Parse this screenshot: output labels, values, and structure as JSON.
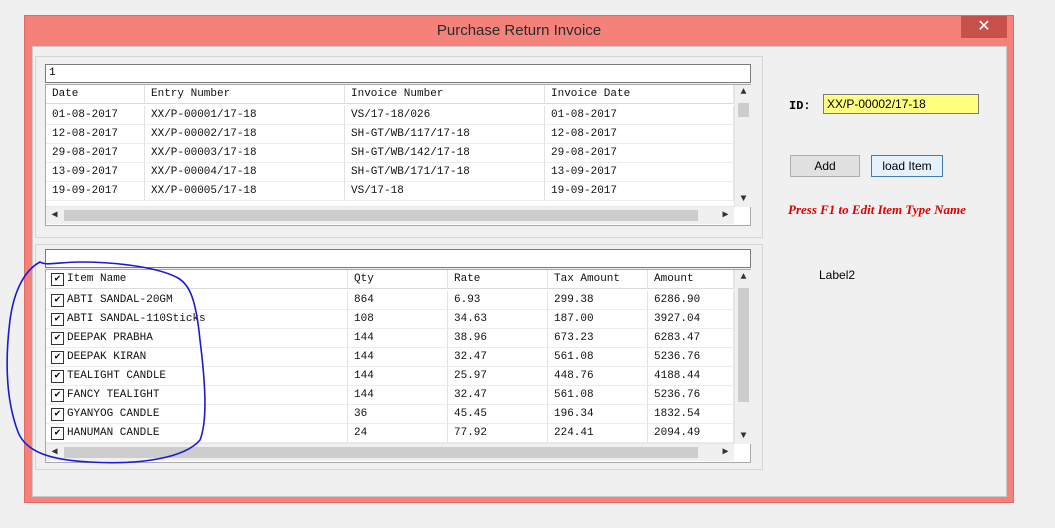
{
  "window": {
    "title": "Purchase Return Invoice",
    "close_glyph": "✕"
  },
  "top_grid": {
    "filter_value": "1",
    "columns": [
      "Date",
      "Entry Number",
      "Invoice Number",
      "Invoice Date"
    ],
    "rows": [
      [
        "01-08-2017",
        "XX/P-00001/17-18",
        "VS/17-18/026",
        "01-08-2017"
      ],
      [
        "12-08-2017",
        "XX/P-00002/17-18",
        "SH-GT/WB/117/17-18",
        "12-08-2017"
      ],
      [
        "29-08-2017",
        "XX/P-00003/17-18",
        "SH-GT/WB/142/17-18",
        "29-08-2017"
      ],
      [
        "13-09-2017",
        "XX/P-00004/17-18",
        "SH-GT/WB/171/17-18",
        "13-09-2017"
      ],
      [
        "19-09-2017",
        "XX/P-00005/17-18",
        "VS/17-18",
        "19-09-2017"
      ]
    ]
  },
  "bottom_grid": {
    "filter_value": "",
    "columns": [
      "Item Name",
      "Qty",
      "Rate",
      "Tax Amount",
      "Amount"
    ],
    "rows": [
      [
        "ABTI SANDAL-20GM",
        "864",
        "6.93",
        "299.38",
        "6286.90"
      ],
      [
        "ABTI SANDAL-110Sticks",
        "108",
        "34.63",
        "187.00",
        "3927.04"
      ],
      [
        "DEEPAK PRABHA",
        "144",
        "38.96",
        "673.23",
        "6283.47"
      ],
      [
        "DEEPAK KIRAN",
        "144",
        "32.47",
        "561.08",
        "5236.76"
      ],
      [
        "TEALIGHT CANDLE",
        "144",
        "25.97",
        "448.76",
        "4188.44"
      ],
      [
        "FANCY TEALIGHT",
        "144",
        "32.47",
        "561.08",
        "5236.76"
      ],
      [
        "GYANYOG CANDLE",
        "36",
        "45.45",
        "196.34",
        "1832.54"
      ],
      [
        "HANUMAN CANDLE",
        "24",
        "77.92",
        "224.41",
        "2094.49"
      ]
    ]
  },
  "side": {
    "id_label": "ID:",
    "id_value": "XX/P-00002/17-18",
    "add_label": "Add",
    "load_label": "load Item",
    "hint": "Press F1 to Edit Item Type Name",
    "label2": "Label2"
  },
  "colors": {
    "window_frame": "#f4827a",
    "id_field_bg": "#ffff80",
    "hint_text": "#e00000",
    "annotation_stroke": "#1a1ad8"
  }
}
